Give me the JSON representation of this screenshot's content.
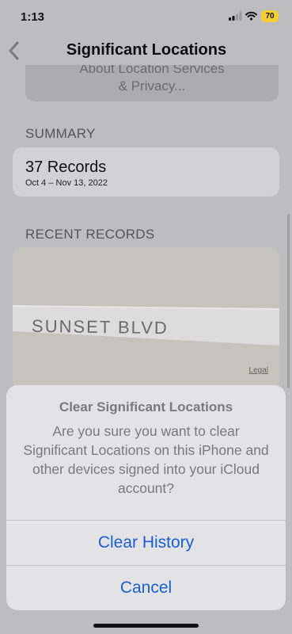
{
  "status_bar": {
    "time": "1:13",
    "battery": "70"
  },
  "nav": {
    "title": "Significant Locations"
  },
  "about_link": {
    "line1": "About Location Services",
    "line2": "& Privacy..."
  },
  "summary": {
    "header": "SUMMARY",
    "records": "37 Records",
    "range": "Oct 4 – Nov 13, 2022"
  },
  "recent": {
    "header": "RECENT RECORDS",
    "map_street": "SUNSET BLVD",
    "legal": "Legal"
  },
  "alert": {
    "title": "Clear Significant Locations",
    "message": "Are you sure you want to clear Significant Locations on this iPhone and other devices signed into your iCloud account?",
    "primary_button": "Clear History",
    "cancel_button": "Cancel"
  },
  "colors": {
    "accent": "#1a5fd0",
    "battery": "#f2cf33"
  }
}
